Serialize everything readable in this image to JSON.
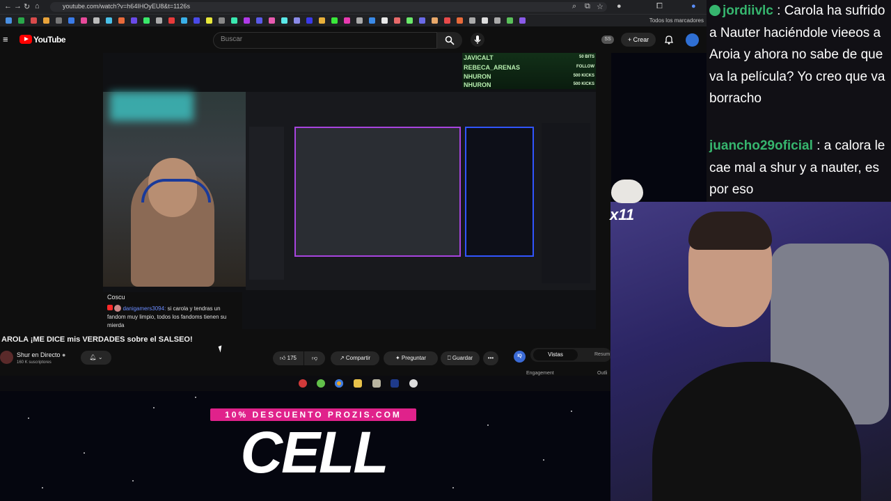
{
  "browser": {
    "url": "youtube.com/watch?v=h64IHOyEU8&t=1126s",
    "bookmarks_folder": "Todos los marcadores"
  },
  "youtube": {
    "logo_text": "YouTube",
    "search_placeholder": "Buscar",
    "create_label": "Crear",
    "ss_chip": "SS"
  },
  "player": {
    "alerts": [
      {
        "name": "JAVICALT",
        "value": "50 BITS"
      },
      {
        "name": "REBECA_ARENAS",
        "value": "FOLLOW"
      },
      {
        "name": "NHURON",
        "value": "500 KICKS"
      },
      {
        "name": "NHURON",
        "value": "500 KICKS"
      }
    ],
    "cosmo_chat": {
      "channel": "Coscu",
      "user": "danigamers3094:",
      "message": "si carola y tendras un fandom muy limpio, todos los fandoms tienen su mierda"
    }
  },
  "video": {
    "title": "AROLA ¡ME DICE mis VERDADES sobre el SALSEO!",
    "channel_name": "Shur en Directo",
    "subscribers": "160 K suscriptores",
    "likes": "175",
    "share_label": "Compartir",
    "ask_label": "Preguntar",
    "save_label": "Guardar",
    "side_tab_active": "Vistas",
    "side_tab_other": "Resum",
    "side_engagement": "Engagement",
    "side_outline": "Outli",
    "iq_label": "IQ"
  },
  "promo": {
    "tag": "10% DESCUENTO PROZIS.COM",
    "big_text": "CELL"
  },
  "twitch_chat": [
    {
      "user": "jordiivlc",
      "text": " : Carola ha sufrido a Nauter haciéndole vieeos a Aroia y ahora no sabe de que va la película? Yo creo que va borracho",
      "badge": true
    },
    {
      "user": "juancho29oficial",
      "text": " : a calora le cae mal a shur y a nauter, es por eso",
      "badge": false
    }
  ],
  "emote": {
    "count": "x11"
  },
  "colors": {
    "youtube_red": "#ff0000",
    "chat_username": "#36b56e",
    "promo_pink": "#e0228b",
    "alert_green": "#b8f0b0"
  }
}
